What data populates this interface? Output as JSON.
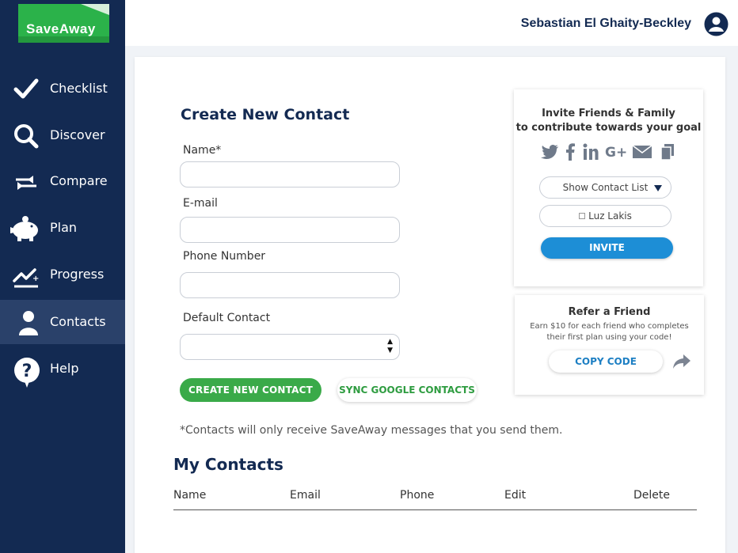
{
  "brand": {
    "logo_text": "SaveAway",
    "accent": "#2bb24a",
    "sidebar_bg": "#132a52"
  },
  "header": {
    "user_name": "Sebastian El Ghaity-Beckley",
    "avatar_icon": "user-circle-icon"
  },
  "sidebar": {
    "items": [
      {
        "label": "Checklist",
        "icon": "checkmark-icon"
      },
      {
        "label": "Discover",
        "icon": "search-icon"
      },
      {
        "label": "Compare",
        "icon": "compare-arrows-icon"
      },
      {
        "label": "Plan",
        "icon": "piggy-bank-icon"
      },
      {
        "label": "Progress",
        "icon": "progress-chart-icon"
      },
      {
        "label": "Contacts",
        "icon": "person-icon",
        "active": true
      },
      {
        "label": "Help",
        "icon": "help-icon"
      }
    ]
  },
  "form": {
    "title": "Create New Contact",
    "name_label": "Name*",
    "name_value": "",
    "email_label": "E-mail",
    "email_value": "",
    "phone_label": "Phone Number",
    "phone_value": "",
    "default_label": "Default Contact",
    "default_value": "",
    "create_button": "CREATE NEW CONTACT",
    "sync_button": "SYNC GOOGLE CONTACTS",
    "note": "*Contacts will only receive SaveAway messages that you send them."
  },
  "contacts": {
    "title": "My Contacts",
    "columns": [
      "Name",
      "Email",
      "Phone",
      "Edit",
      "Delete"
    ],
    "rows": []
  },
  "invite": {
    "line1": "Invite Friends & Family",
    "line2": "to contribute towards your goal",
    "share_icons": [
      "twitter-icon",
      "facebook-icon",
      "linkedin-icon",
      "google-plus-icon",
      "email-icon",
      "copy-icon"
    ],
    "contact_list_dropdown": "Show Contact List",
    "selected_contact": "Luz Lakis",
    "invite_button": "INVITE"
  },
  "refer": {
    "title": "Refer a Friend",
    "description": "Earn $10 for each friend who completes their first plan using your code!",
    "copy_button": "COPY CODE",
    "forward_icon": "share-forward-icon"
  }
}
